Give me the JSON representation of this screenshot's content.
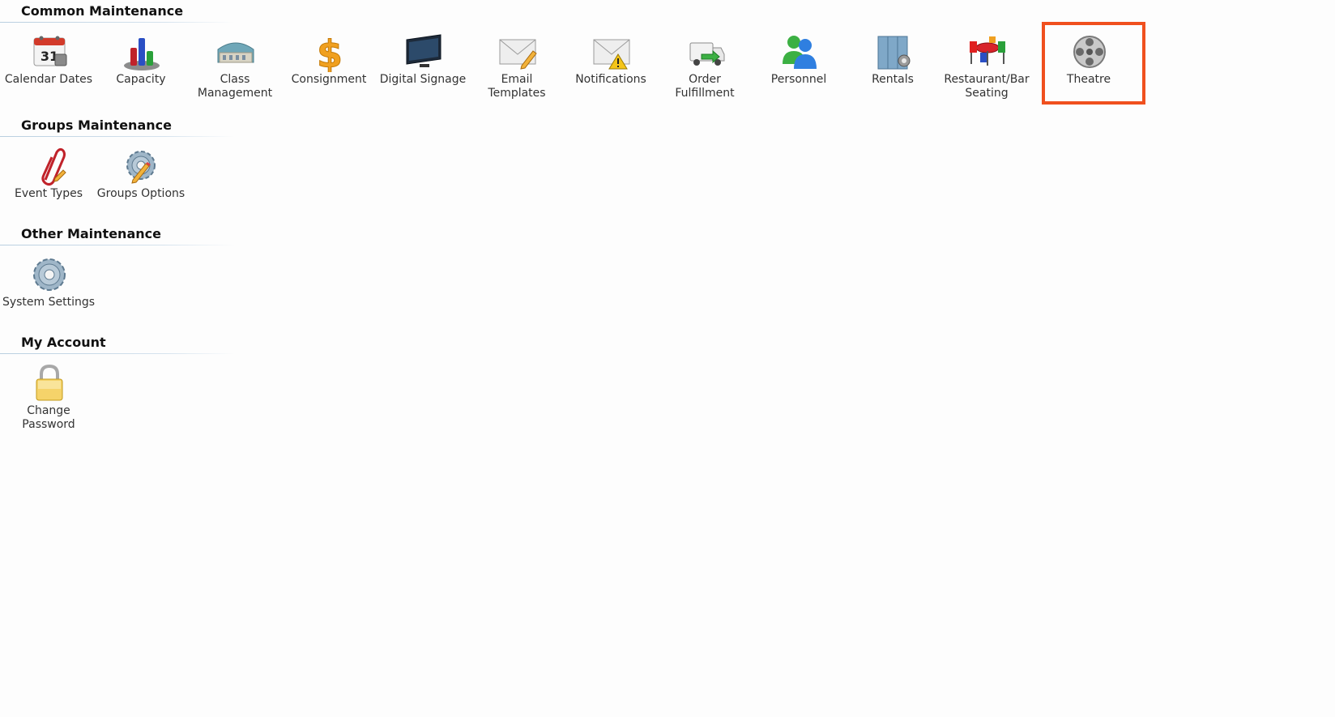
{
  "sections": {
    "common": {
      "title": "Common Maintenance",
      "items": [
        {
          "label": "Calendar Dates",
          "icon": "calendar-icon"
        },
        {
          "label": "Capacity",
          "icon": "bar-chart-icon"
        },
        {
          "label": "Class\nManagement",
          "icon": "building-icon"
        },
        {
          "label": "Consignment",
          "icon": "dollar-icon"
        },
        {
          "label": "Digital Signage",
          "icon": "monitor-icon"
        },
        {
          "label": "Email\nTemplates",
          "icon": "envelope-pencil-icon"
        },
        {
          "label": "Notifications",
          "icon": "envelope-warning-icon"
        },
        {
          "label": "Order\nFulfillment",
          "icon": "delivery-truck-icon"
        },
        {
          "label": "Personnel",
          "icon": "people-icon"
        },
        {
          "label": "Rentals",
          "icon": "locker-icon"
        },
        {
          "label": "Restaurant/Bar\nSeating",
          "icon": "table-chairs-icon"
        },
        {
          "label": "Theatre",
          "icon": "film-reel-icon",
          "selected": true
        }
      ]
    },
    "groups": {
      "title": "Groups Maintenance",
      "items": [
        {
          "label": "Event Types",
          "icon": "paperclip-icon"
        },
        {
          "label": "Groups Options",
          "icon": "gear-pencil-icon"
        }
      ]
    },
    "other": {
      "title": "Other Maintenance",
      "items": [
        {
          "label": "System Settings",
          "icon": "gear-icon"
        }
      ]
    },
    "account": {
      "title": "My Account",
      "items": [
        {
          "label": "Change\nPassword",
          "icon": "lock-icon"
        }
      ]
    }
  },
  "colors": {
    "highlight": "#f0501e",
    "rule": "#b9cfe0"
  }
}
